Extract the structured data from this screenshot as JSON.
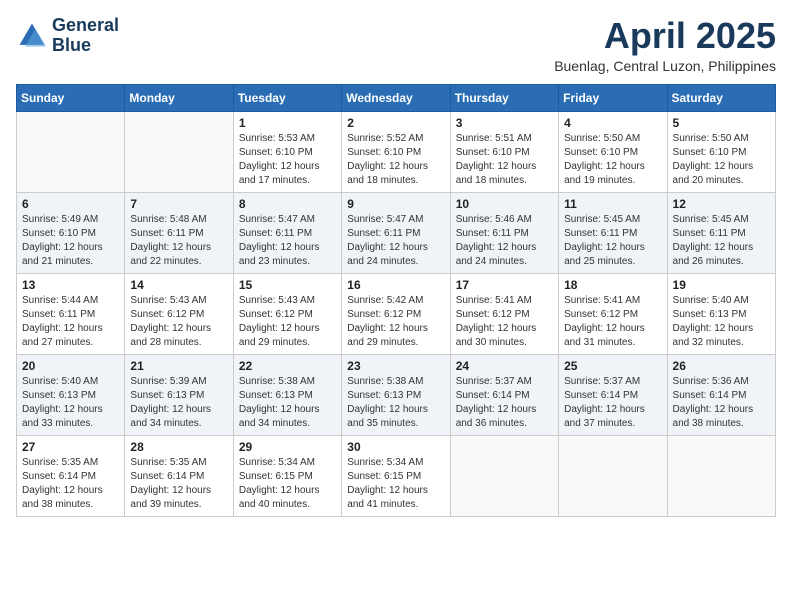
{
  "header": {
    "logo_line1": "General",
    "logo_line2": "Blue",
    "month_title": "April 2025",
    "location": "Buenlag, Central Luzon, Philippines"
  },
  "days_of_week": [
    "Sunday",
    "Monday",
    "Tuesday",
    "Wednesday",
    "Thursday",
    "Friday",
    "Saturday"
  ],
  "weeks": [
    [
      {
        "day": "",
        "info": ""
      },
      {
        "day": "",
        "info": ""
      },
      {
        "day": "1",
        "info": "Sunrise: 5:53 AM\nSunset: 6:10 PM\nDaylight: 12 hours\nand 17 minutes."
      },
      {
        "day": "2",
        "info": "Sunrise: 5:52 AM\nSunset: 6:10 PM\nDaylight: 12 hours\nand 18 minutes."
      },
      {
        "day": "3",
        "info": "Sunrise: 5:51 AM\nSunset: 6:10 PM\nDaylight: 12 hours\nand 18 minutes."
      },
      {
        "day": "4",
        "info": "Sunrise: 5:50 AM\nSunset: 6:10 PM\nDaylight: 12 hours\nand 19 minutes."
      },
      {
        "day": "5",
        "info": "Sunrise: 5:50 AM\nSunset: 6:10 PM\nDaylight: 12 hours\nand 20 minutes."
      }
    ],
    [
      {
        "day": "6",
        "info": "Sunrise: 5:49 AM\nSunset: 6:10 PM\nDaylight: 12 hours\nand 21 minutes."
      },
      {
        "day": "7",
        "info": "Sunrise: 5:48 AM\nSunset: 6:11 PM\nDaylight: 12 hours\nand 22 minutes."
      },
      {
        "day": "8",
        "info": "Sunrise: 5:47 AM\nSunset: 6:11 PM\nDaylight: 12 hours\nand 23 minutes."
      },
      {
        "day": "9",
        "info": "Sunrise: 5:47 AM\nSunset: 6:11 PM\nDaylight: 12 hours\nand 24 minutes."
      },
      {
        "day": "10",
        "info": "Sunrise: 5:46 AM\nSunset: 6:11 PM\nDaylight: 12 hours\nand 24 minutes."
      },
      {
        "day": "11",
        "info": "Sunrise: 5:45 AM\nSunset: 6:11 PM\nDaylight: 12 hours\nand 25 minutes."
      },
      {
        "day": "12",
        "info": "Sunrise: 5:45 AM\nSunset: 6:11 PM\nDaylight: 12 hours\nand 26 minutes."
      }
    ],
    [
      {
        "day": "13",
        "info": "Sunrise: 5:44 AM\nSunset: 6:11 PM\nDaylight: 12 hours\nand 27 minutes."
      },
      {
        "day": "14",
        "info": "Sunrise: 5:43 AM\nSunset: 6:12 PM\nDaylight: 12 hours\nand 28 minutes."
      },
      {
        "day": "15",
        "info": "Sunrise: 5:43 AM\nSunset: 6:12 PM\nDaylight: 12 hours\nand 29 minutes."
      },
      {
        "day": "16",
        "info": "Sunrise: 5:42 AM\nSunset: 6:12 PM\nDaylight: 12 hours\nand 29 minutes."
      },
      {
        "day": "17",
        "info": "Sunrise: 5:41 AM\nSunset: 6:12 PM\nDaylight: 12 hours\nand 30 minutes."
      },
      {
        "day": "18",
        "info": "Sunrise: 5:41 AM\nSunset: 6:12 PM\nDaylight: 12 hours\nand 31 minutes."
      },
      {
        "day": "19",
        "info": "Sunrise: 5:40 AM\nSunset: 6:13 PM\nDaylight: 12 hours\nand 32 minutes."
      }
    ],
    [
      {
        "day": "20",
        "info": "Sunrise: 5:40 AM\nSunset: 6:13 PM\nDaylight: 12 hours\nand 33 minutes."
      },
      {
        "day": "21",
        "info": "Sunrise: 5:39 AM\nSunset: 6:13 PM\nDaylight: 12 hours\nand 34 minutes."
      },
      {
        "day": "22",
        "info": "Sunrise: 5:38 AM\nSunset: 6:13 PM\nDaylight: 12 hours\nand 34 minutes."
      },
      {
        "day": "23",
        "info": "Sunrise: 5:38 AM\nSunset: 6:13 PM\nDaylight: 12 hours\nand 35 minutes."
      },
      {
        "day": "24",
        "info": "Sunrise: 5:37 AM\nSunset: 6:14 PM\nDaylight: 12 hours\nand 36 minutes."
      },
      {
        "day": "25",
        "info": "Sunrise: 5:37 AM\nSunset: 6:14 PM\nDaylight: 12 hours\nand 37 minutes."
      },
      {
        "day": "26",
        "info": "Sunrise: 5:36 AM\nSunset: 6:14 PM\nDaylight: 12 hours\nand 38 minutes."
      }
    ],
    [
      {
        "day": "27",
        "info": "Sunrise: 5:35 AM\nSunset: 6:14 PM\nDaylight: 12 hours\nand 38 minutes."
      },
      {
        "day": "28",
        "info": "Sunrise: 5:35 AM\nSunset: 6:14 PM\nDaylight: 12 hours\nand 39 minutes."
      },
      {
        "day": "29",
        "info": "Sunrise: 5:34 AM\nSunset: 6:15 PM\nDaylight: 12 hours\nand 40 minutes."
      },
      {
        "day": "30",
        "info": "Sunrise: 5:34 AM\nSunset: 6:15 PM\nDaylight: 12 hours\nand 41 minutes."
      },
      {
        "day": "",
        "info": ""
      },
      {
        "day": "",
        "info": ""
      },
      {
        "day": "",
        "info": ""
      }
    ]
  ]
}
